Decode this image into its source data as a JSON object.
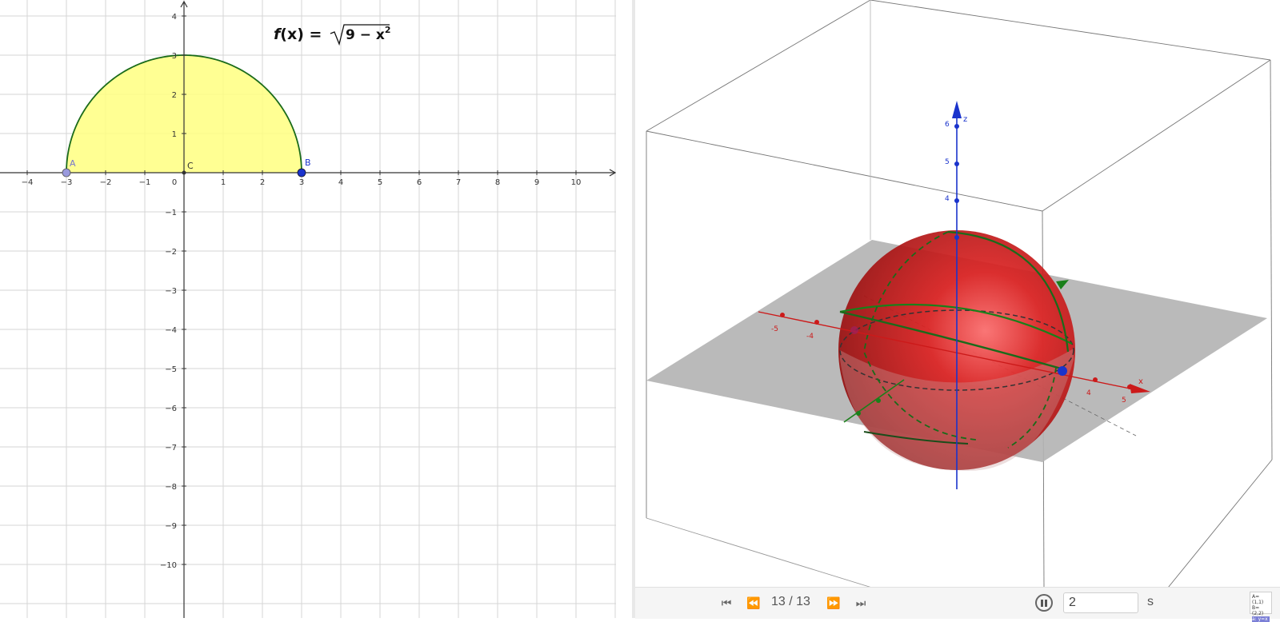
{
  "graphics2d": {
    "function_label": "f(x) = √(9 − x²)",
    "function_name": "f",
    "function_arg": "(x)",
    "function_body": "9 − x",
    "function_exp": "2",
    "x_ticks": [
      "−4",
      "−3",
      "−2",
      "−1",
      "0",
      "1",
      "2",
      "3",
      "4",
      "5",
      "6",
      "7",
      "8",
      "9",
      "10"
    ],
    "y_ticks_pos": [
      "1",
      "2",
      "3",
      "4"
    ],
    "y_ticks_neg": [
      "−1",
      "−2",
      "−3",
      "−4",
      "−5",
      "−6",
      "−7",
      "−8",
      "−9",
      "−10"
    ],
    "points": {
      "A": "A",
      "B": "B",
      "C": "C"
    },
    "colors": {
      "fill": "#ffff80",
      "curve": "#1a6b1a",
      "point_a": "#9999dd",
      "point_b": "#1a33cc"
    }
  },
  "graphics3d": {
    "axis_z_label": "z",
    "axis_x_label": "x",
    "z_ticks": [
      "6",
      "5",
      "4"
    ],
    "x_ticks_neg": [
      "-5",
      "-4"
    ],
    "x_ticks_pos": [
      "4",
      "5"
    ],
    "colors": {
      "sphere": "#cc1a1a",
      "plane": "#b3b3b3",
      "z_axis": "#1a33cc",
      "x_axis": "#cc1a1a",
      "y_axis": "#1a801a"
    }
  },
  "toolbar": {
    "step_counter": "13 / 13",
    "interval_value": "2",
    "interval_unit": "s",
    "icons": [
      "skip-first-icon",
      "step-back-icon",
      "step-forward-icon",
      "skip-last-icon",
      "pause-icon",
      "algebra-view-icon"
    ],
    "algebra_lines": [
      "A=(1,1)",
      "B=(2,2)",
      "a: y=x"
    ]
  }
}
